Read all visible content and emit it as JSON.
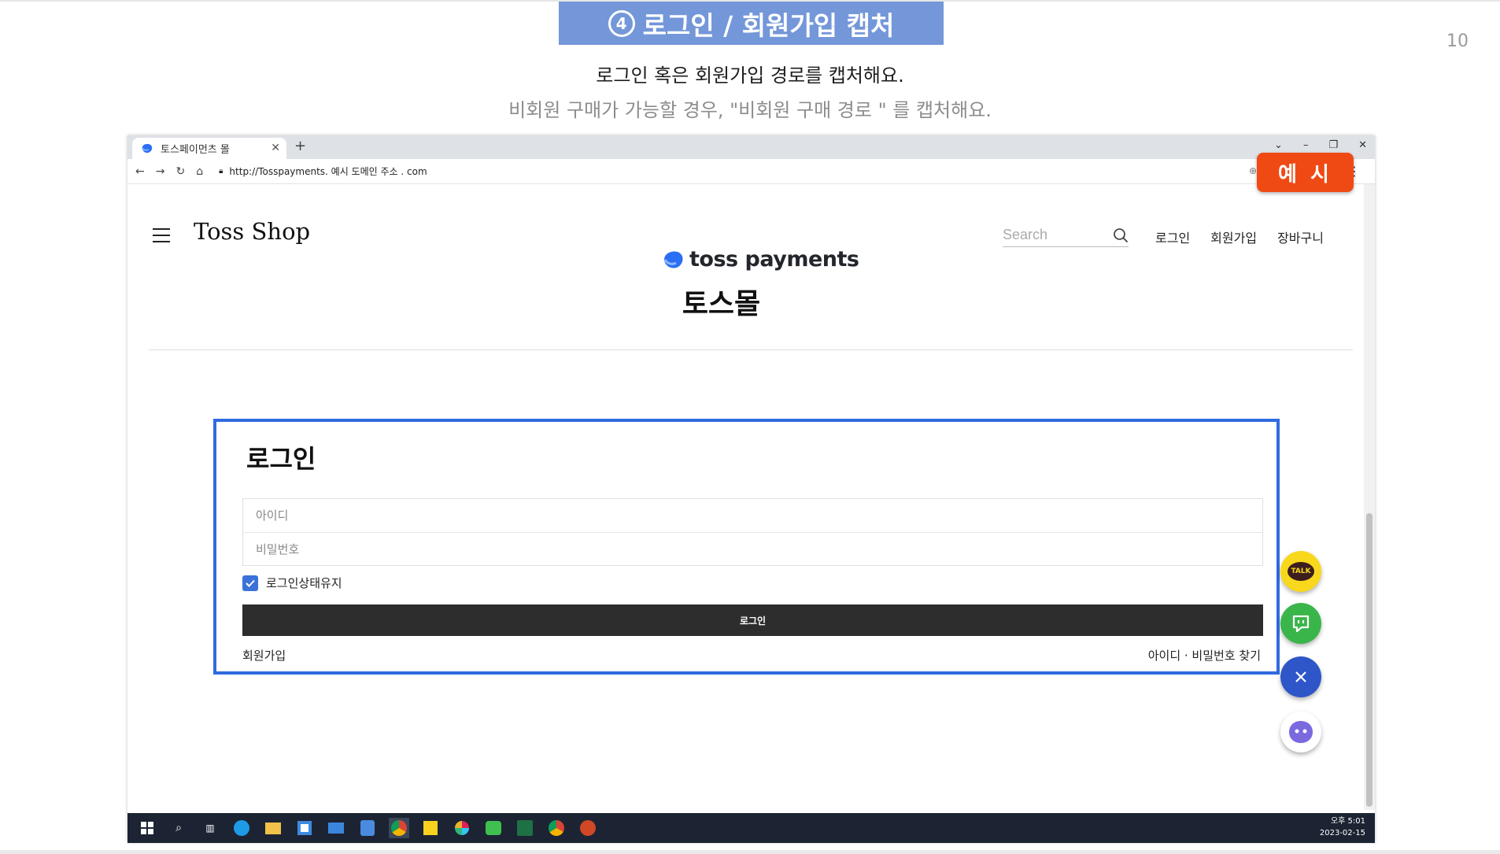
{
  "slide": {
    "step_number": "4",
    "title": "로그인 / 회원가입 캡처",
    "page_number": "10",
    "subtitle_main": "로그인 혹은 회원가입 경로를 캡처해요.",
    "subtitle_note": "비회원 구매가 가능할 경우, \"비회원 구매 경로 \" 를 캡처해요.",
    "example_badge": "예 시"
  },
  "browser": {
    "tab_title": "토스페이먼츠 몰",
    "new_tab": "+",
    "url": "http://Tosspayments. 예시 도메인 주소 . com"
  },
  "site": {
    "shop_name": "Toss Shop",
    "search_placeholder": "Search",
    "nav": {
      "login": "로그인",
      "signup": "회원가입",
      "cart": "장바구니"
    },
    "brand_name": "toss payments",
    "brand_sub": "토스몰"
  },
  "login_form": {
    "title": "로그인",
    "id_placeholder": "아이디",
    "password_placeholder": "비밀번호",
    "keep_logged_in": "로그인상태유지",
    "keep_logged_in_checked": true,
    "submit_label": "로그인",
    "signup_link": "회원가입",
    "find_link": "아이디 · 비밀번호 찾기"
  },
  "floating_buttons": {
    "talk_label": "TALK"
  },
  "taskbar": {
    "time": "오후 5:01",
    "date": "2023-02-15"
  },
  "colors": {
    "title_bg": "#7497d9",
    "badge": "#f04a14",
    "highlight_border": "#2f6be0",
    "login_button": "#2d2d2d"
  }
}
